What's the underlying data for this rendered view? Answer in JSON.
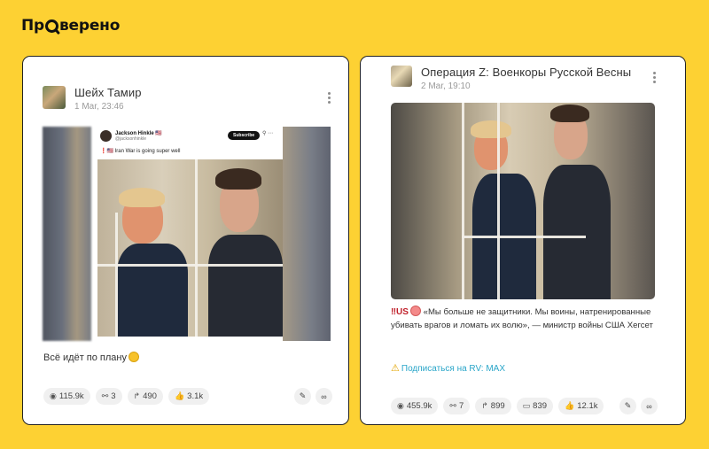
{
  "brand": {
    "logo_pre": "Пр",
    "logo_post": "верено"
  },
  "left_post": {
    "author": "Шейх Тамир",
    "date": "1 Mar, 23:46",
    "tweet": {
      "name": "Jackson Hinkle 🇺🇸",
      "handle": "@jacksonhinkle",
      "subscribe": "Subscribe",
      "icons": "⚲ ⋯",
      "text": "❗🇺🇸 Iran War is going super well"
    },
    "caption": "Всё идёт по плану",
    "stats": {
      "views": "115.9k",
      "shares": "3",
      "reposts": "490",
      "likes": "3.1k"
    }
  },
  "right_post": {
    "author": "Операция Z: Военкоры Русской Весны",
    "date": "2 Mar, 19:10",
    "text_flag": "‼US",
    "text": "«Мы больше не защитники. Мы воины, натренированные убивать врагов и ломать их волю», — министр войны США Хегсет",
    "subscribe_label": "Подписаться на RV: MAX",
    "stats": {
      "views": "455.9k",
      "shares": "7",
      "reposts": "899",
      "comments": "839",
      "likes": "12.1k"
    }
  },
  "icons": {
    "views": "eye-icon",
    "shares": "share-icon",
    "reposts": "repost-icon",
    "likes": "thumbs-up-icon",
    "comments": "comments-icon",
    "edit": "pencil-icon",
    "link": "link-icon",
    "menu": "kebab-menu-icon"
  },
  "colors": {
    "background": "#fdd133",
    "card_border": "#222222",
    "link": "#2aa6c9",
    "flag": "#c0202a"
  }
}
